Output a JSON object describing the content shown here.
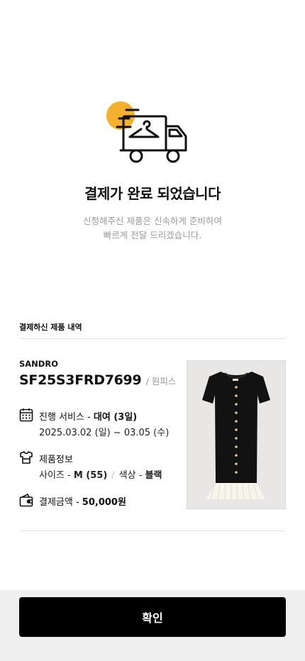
{
  "hero": {
    "title_prefix": "결제가 ",
    "title_bold": "완료",
    "title_suffix": " 되었습니다",
    "subtitle_line1": "신청해주신 제품은 신속하게 준비하여",
    "subtitle_line2": "빠르게 전달 드리겠습니다.",
    "icon": "delivery-truck-icon",
    "accent_color": "#F5B02E"
  },
  "order": {
    "section_title": "결제하신 제품 내역",
    "brand": "SANDRO",
    "product_code": "SF25S3FRD7699",
    "category": "/ 원피스",
    "service": {
      "icon": "calendar-icon",
      "label": "진행 서비스 - ",
      "value": "대여 (3일)",
      "period": "2025.03.02 (일) ~ 03.05 (수)"
    },
    "product_info": {
      "icon": "tshirt-icon",
      "label": "제품정보",
      "size_label": "사이즈 - ",
      "size_value": "M (55)",
      "color_label": "색상 - ",
      "color_value": "블랙"
    },
    "payment": {
      "icon": "wallet-icon",
      "label": "결제금액 - ",
      "value": "50,000원"
    }
  },
  "footer": {
    "confirm_label": "확인"
  }
}
